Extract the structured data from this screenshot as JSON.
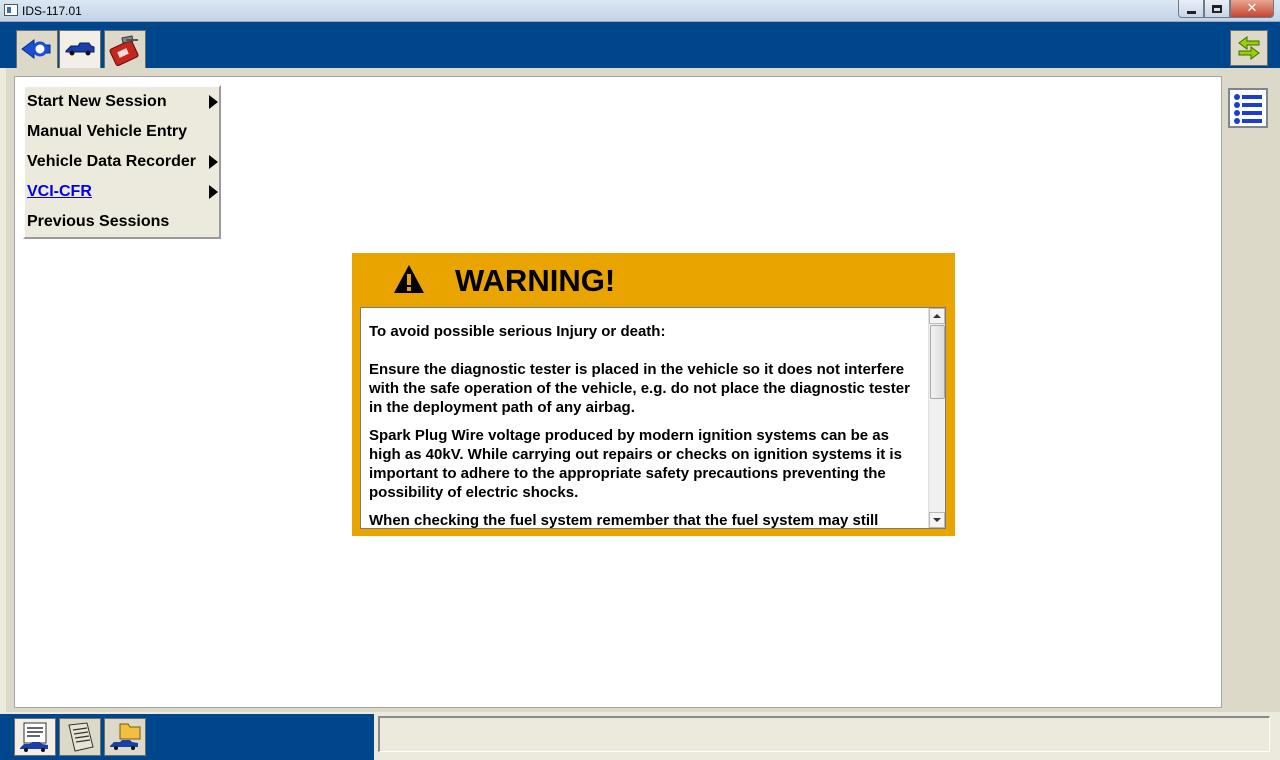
{
  "window": {
    "title": "IDS-117.01",
    "controls": [
      "minimize",
      "maximize",
      "close"
    ],
    "close_glyph": "✕"
  },
  "toolbar": {
    "tabs": [
      {
        "icon": "back-arrow-icon",
        "active": false
      },
      {
        "icon": "vehicle-icon",
        "active": true
      },
      {
        "icon": "toolbox-icon",
        "active": false
      }
    ],
    "right_button_icon": "exchange-arrows-icon"
  },
  "menu": {
    "items": [
      {
        "label": "Start New Session",
        "has_submenu": true,
        "link": false
      },
      {
        "label": "Manual Vehicle Entry",
        "has_submenu": false,
        "link": false
      },
      {
        "label": "Vehicle Data Recorder",
        "has_submenu": true,
        "link": false
      },
      {
        "label": "VCI-CFR",
        "has_submenu": true,
        "link": true
      },
      {
        "label": "Previous Sessions",
        "has_submenu": false,
        "link": false
      }
    ]
  },
  "warning": {
    "title": "WARNING!",
    "lead": "To avoid possible serious Injury or death:",
    "paragraphs": [
      "Ensure the diagnostic tester is placed in the vehicle so it does not interfere with the safe operation of the vehicle, e.g. do not place the diagnostic tester in the deployment path of any airbag.",
      "Spark Plug Wire voltage produced by modern ignition systems can be as high as 40kV. While carrying out repairs or checks on ignition systems it is important to adhere to the appropriate safety precautions preventing the possibility of electric shocks.",
      "When checking the fuel system remember that the fuel system may still"
    ]
  },
  "sidebar": {
    "button_icon": "list-icon"
  },
  "bottom": {
    "tabs": [
      {
        "icon": "vehicle-info-icon",
        "active": true
      },
      {
        "icon": "notes-icon",
        "active": false
      },
      {
        "icon": "vehicle-folder-icon",
        "active": false
      }
    ],
    "status_text": ""
  },
  "colors": {
    "header_blue": "#00468c",
    "warning_amber": "#e9a400",
    "panel_beige": "#ddd9c8",
    "link_blue": "#0000ee"
  }
}
